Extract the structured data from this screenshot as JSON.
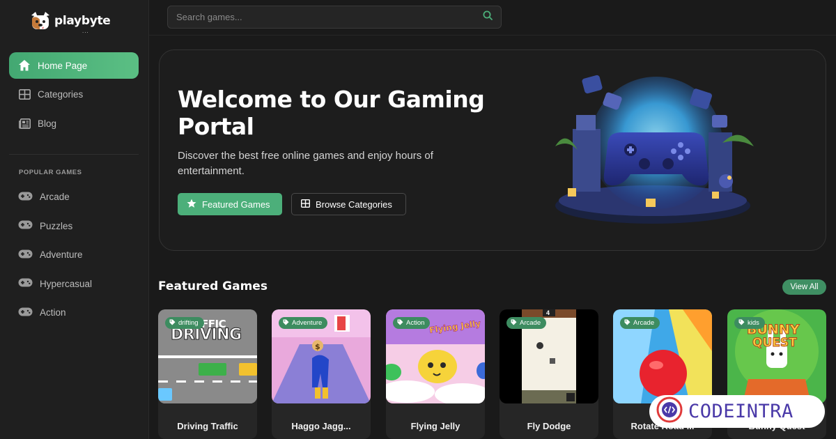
{
  "brand": {
    "name": "playbyte",
    "dots": "..."
  },
  "sidebar": {
    "nav": [
      {
        "label": "Home Page",
        "icon": "home-icon",
        "active": true
      },
      {
        "label": "Categories",
        "icon": "grid-icon",
        "active": false
      },
      {
        "label": "Blog",
        "icon": "newspaper-icon",
        "active": false
      }
    ],
    "popular_title": "POPULAR GAMES",
    "popular": [
      {
        "label": "Arcade",
        "icon": "gamepad-icon"
      },
      {
        "label": "Puzzles",
        "icon": "gamepad-icon"
      },
      {
        "label": "Adventure",
        "icon": "gamepad-icon"
      },
      {
        "label": "Hypercasual",
        "icon": "gamepad-icon"
      },
      {
        "label": "Action",
        "icon": "gamepad-icon"
      }
    ]
  },
  "search": {
    "placeholder": "Search games...",
    "value": ""
  },
  "hero": {
    "title": "Welcome to Our Gaming Portal",
    "subtitle": "Discover the best free online games and enjoy hours of entertainment.",
    "primary_button": "Featured Games",
    "secondary_button": "Browse Categories"
  },
  "featured": {
    "title": "Featured Games",
    "view_all": "View All",
    "games": [
      {
        "title": "Driving Traffic",
        "tag": "drifting"
      },
      {
        "title": "Haggo Jagg...",
        "tag": "Adventure"
      },
      {
        "title": "Flying Jelly",
        "tag": "Action"
      },
      {
        "title": "Fly Dodge",
        "tag": "Arcade"
      },
      {
        "title": "Rotate Road ...",
        "tag": "Arcade"
      },
      {
        "title": "Bunny Quest",
        "tag": "kids"
      }
    ],
    "thumb_text": {
      "driving": "DRIVING",
      "driving_top": "FFIC",
      "jelly": "Flying Jelly",
      "bunny_top": "BUNNY",
      "bunny_bottom": "QUEST",
      "dodge_score": "4"
    }
  },
  "watermark": {
    "text": "CODEINTRA"
  },
  "colors": {
    "accent": "#4caf7a",
    "bg": "#1a1a1a",
    "sidebar": "#1f1f1f",
    "card": "#262626"
  }
}
